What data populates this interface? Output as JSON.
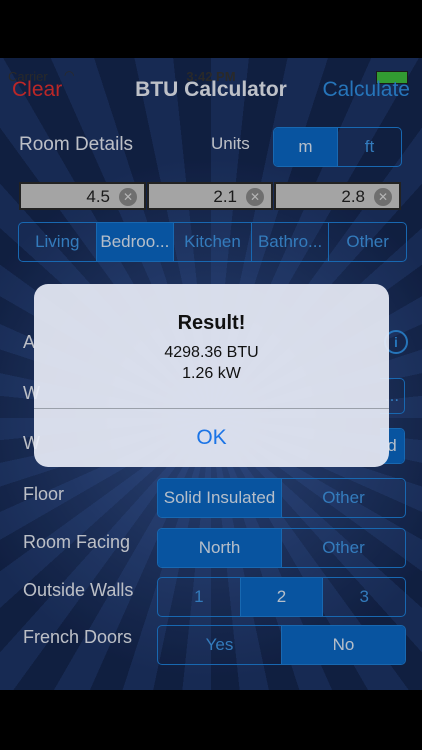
{
  "status": {
    "carrier": "Carrier",
    "time": "3:42 PM"
  },
  "nav": {
    "clear": "Clear",
    "title": "BTU Calculator",
    "calculate": "Calculate"
  },
  "room": {
    "label": "Room Details",
    "units_label": "Units",
    "units": [
      "m",
      "ft"
    ],
    "dimensions": [
      "4.5",
      "2.1",
      "2.8"
    ],
    "types": [
      "Living",
      "Bedroo...",
      "Kitchen",
      "Bathro...",
      "Other"
    ]
  },
  "hidden_rows": {
    "row_a": "A",
    "row_w1": "W",
    "row_w2": "W",
    "seg_w1_tail": "...",
    "seg_w2_tail": "d"
  },
  "floor": {
    "label": "Floor",
    "options": [
      "Solid Insulated",
      "Other"
    ]
  },
  "facing": {
    "label": "Room Facing",
    "options": [
      "North",
      "Other"
    ]
  },
  "walls": {
    "label": "Outside Walls",
    "options": [
      "1",
      "2",
      "3"
    ]
  },
  "french": {
    "label": "French Doors",
    "options": [
      "Yes",
      "No"
    ]
  },
  "alert": {
    "title": "Result!",
    "line1": "4298.36 BTU",
    "line2": "1.26 kW",
    "ok": "OK"
  }
}
